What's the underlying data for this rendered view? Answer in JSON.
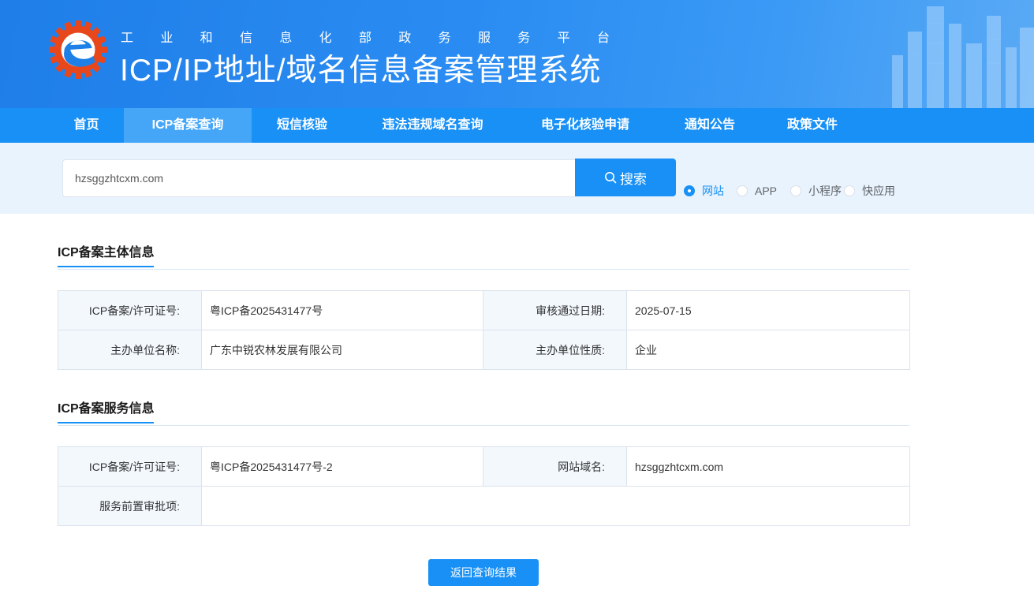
{
  "header": {
    "subtitle_chars": [
      "工",
      "业",
      "和",
      "信",
      "息",
      "化",
      "部",
      "政",
      "务",
      "服",
      "务",
      "平",
      "台"
    ],
    "title": "ICP/IP地址/域名信息备案管理系统",
    "logo_colors": {
      "gear": "#e8471c",
      "e": "#1e80e6"
    }
  },
  "nav": {
    "items": [
      {
        "label": "首页",
        "active": false
      },
      {
        "label": "ICP备案查询",
        "active": true
      },
      {
        "label": "短信核验",
        "active": false
      },
      {
        "label": "违法违规域名查询",
        "active": false
      },
      {
        "label": "电子化核验申请",
        "active": false
      },
      {
        "label": "通知公告",
        "active": false
      },
      {
        "label": "政策文件",
        "active": false
      }
    ]
  },
  "search": {
    "value": "hzsggzhtcxm.com",
    "placeholder": "",
    "button_label": "搜索",
    "button_icon": "search-icon",
    "types": [
      {
        "label": "网站",
        "checked": true
      },
      {
        "label": "APP",
        "checked": false
      },
      {
        "label": "小程序",
        "checked": false
      },
      {
        "label": "快应用",
        "checked": false
      }
    ]
  },
  "sections": {
    "subject": {
      "title": "ICP备案主体信息",
      "rows": [
        {
          "label1": "ICP备案/许可证号:",
          "value1": "粤ICP备2025431477号",
          "label2": "审核通过日期:",
          "value2": "2025-07-15"
        },
        {
          "label1": "主办单位名称:",
          "value1": "广东中锐农林发展有限公司",
          "label2": "主办单位性质:",
          "value2": "企业"
        }
      ]
    },
    "service": {
      "title": "ICP备案服务信息",
      "rows": [
        {
          "label1": "ICP备案/许可证号:",
          "value1": "粤ICP备2025431477号-2",
          "label2": "网站域名:",
          "value2": "hzsggzhtcxm.com"
        }
      ],
      "pre_approval_label": "服务前置审批项:",
      "pre_approval_value": ""
    }
  },
  "back_button_label": "返回查询结果",
  "colors": {
    "primary": "#1890f5",
    "nav_active": "#45a6f7",
    "band": "#e8f3fd",
    "label_bg": "#f3f8fd"
  }
}
